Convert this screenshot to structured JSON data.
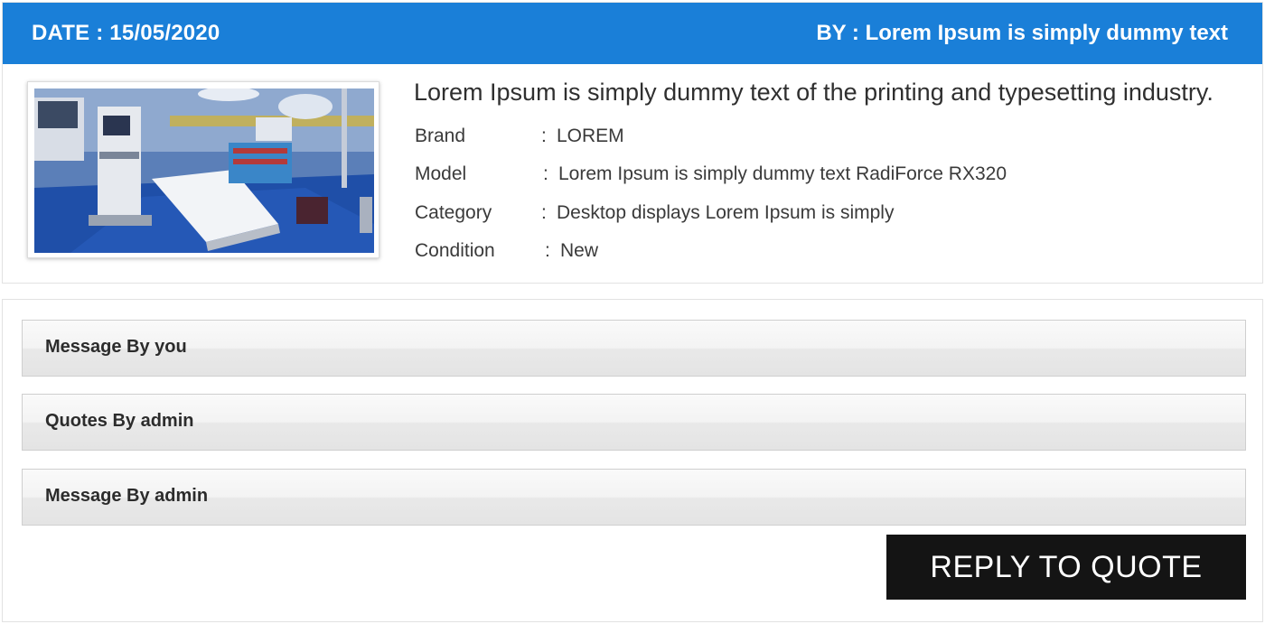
{
  "header": {
    "date_text": "DATE :  15/05/2020",
    "by_text": "BY : Lorem Ipsum is simply dummy text"
  },
  "product": {
    "image_alt": "Operating room with surgical bed and medical equipment",
    "title": "Lorem Ipsum is simply dummy text of the printing and typesetting industry.",
    "specs": [
      {
        "key": "Brand",
        "sep": ":",
        "value": "LOREM"
      },
      {
        "key": "Model",
        "sep": ":",
        "value": "Lorem Ipsum is simply dummy text RadiForce RX320"
      },
      {
        "key": "Category",
        "sep": ":",
        "value": "Desktop displays Lorem Ipsum is simply"
      },
      {
        "key": "Condition",
        "sep": ":",
        "value": "New"
      }
    ]
  },
  "sections": [
    {
      "label": "Message By you"
    },
    {
      "label": "Quotes By admin"
    },
    {
      "label": "Message By admin"
    }
  ],
  "actions": {
    "reply_label": "REPLY TO QUOTE"
  },
  "colors": {
    "header_bg": "#1a7fd8",
    "button_bg": "#141414"
  }
}
